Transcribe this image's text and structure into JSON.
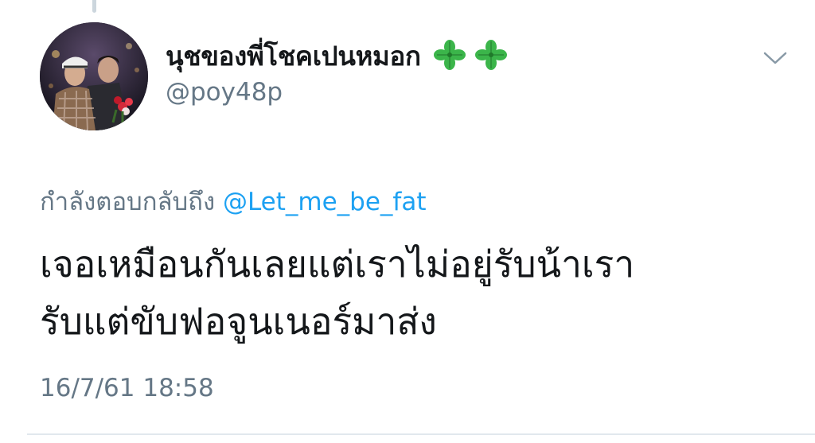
{
  "tweet": {
    "author": {
      "display_name": "นุชของพี่โชคเปนหมอก",
      "name_emoji": [
        "four-leaf-clover",
        "four-leaf-clover"
      ],
      "handle": "@poy48p",
      "avatar": "profile-photo"
    },
    "reply_context": {
      "prefix": "กำลังตอบกลับถึง",
      "mention": "@Let_me_be_fat"
    },
    "text_lines": [
      "เจอเหมือนกันเลยแต่เราไม่อยู่รับน้าเรา",
      "รับแต่ขับฟอจูนเนอร์มาส่ง"
    ],
    "timestamp": "16/7/61 18:58",
    "menu_icon": "chevron-down-icon"
  },
  "colors": {
    "primary_text": "#14171a",
    "secondary_text": "#657786",
    "link": "#1da1f2",
    "divider": "#e1e8ed",
    "clover": "#3bb54a"
  }
}
